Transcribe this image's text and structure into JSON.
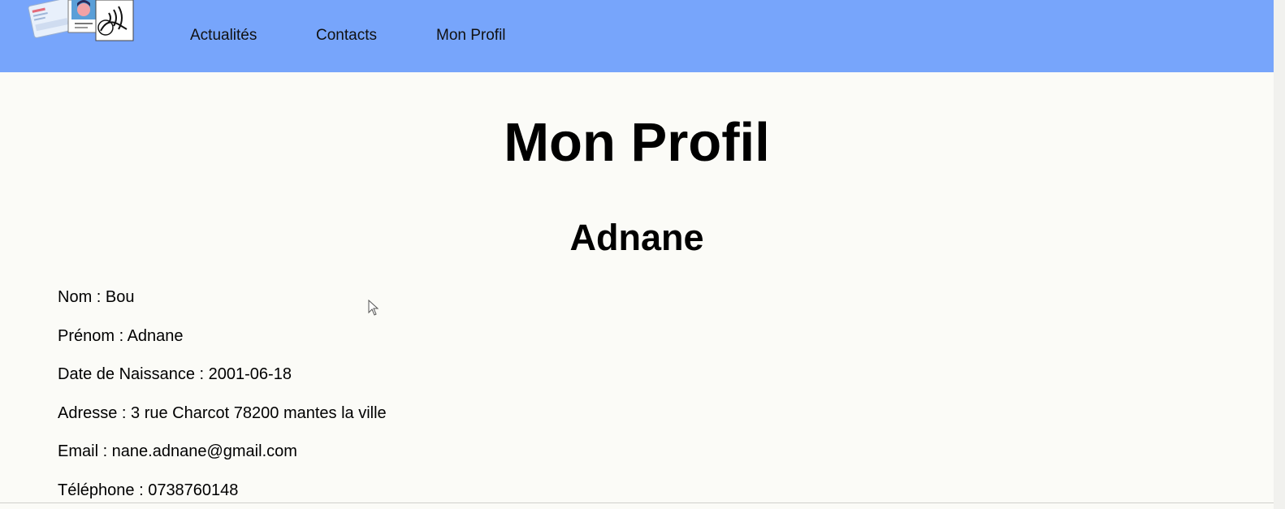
{
  "nav": {
    "links": [
      "Actualités",
      "Contacts",
      "Mon Profil"
    ]
  },
  "main": {
    "title": "Mon Profil",
    "name": "Adnane",
    "fields": [
      "Nom : Bou",
      "Prénom : Adnane",
      "Date de Naissance : 2001-06-18",
      "Adresse : 3 rue Charcot 78200 mantes la ville",
      "Email : nane.adnane@gmail.com",
      "Téléphone : 0738760148"
    ]
  },
  "colors": {
    "navbar": "#77a5fb",
    "background": "#fbfbf7"
  },
  "icons": {
    "logo": "id-card-contactless-logo",
    "cursor": "mouse-pointer-icon"
  }
}
